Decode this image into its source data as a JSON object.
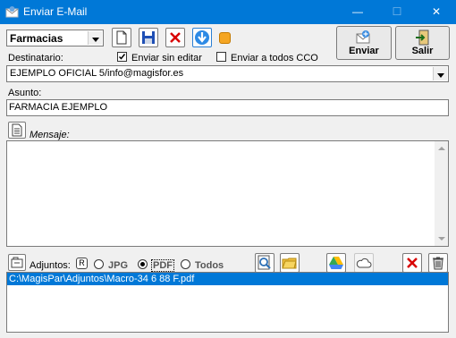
{
  "window": {
    "title": "Enviar E-Mail",
    "minimize": "—",
    "maximize": "☐",
    "close": "✕"
  },
  "toolbar": {
    "account_select": "Farmacias",
    "send_label": "Enviar",
    "exit_label": "Salir"
  },
  "recipient": {
    "label": "Destinatario:",
    "send_without_edit_label": "Enviar sin editar",
    "send_without_edit_checked": true,
    "send_all_bcc_label": "Enviar a todos CCO",
    "send_all_bcc_checked": false,
    "value": "EJEMPLO OFICIAL 5/info@magisfor.es"
  },
  "subject": {
    "label": "Asunto:",
    "value": "FARMACIA EJEMPLO"
  },
  "message": {
    "label": "Mensaje:",
    "value": ""
  },
  "attachments": {
    "label": "Adjuntos:",
    "r_label": "R",
    "jpg_label": "JPG",
    "pdf_label": "PDF",
    "all_label": "Todos",
    "selected_filter": "PDF",
    "files": [
      "C:\\MagisPar\\Adjuntos\\Macro-34 6 88 F.pdf"
    ]
  },
  "colors": {
    "titlebar": "#0078d7",
    "selection": "#0078d7",
    "accent_orange": "#f5a623"
  }
}
